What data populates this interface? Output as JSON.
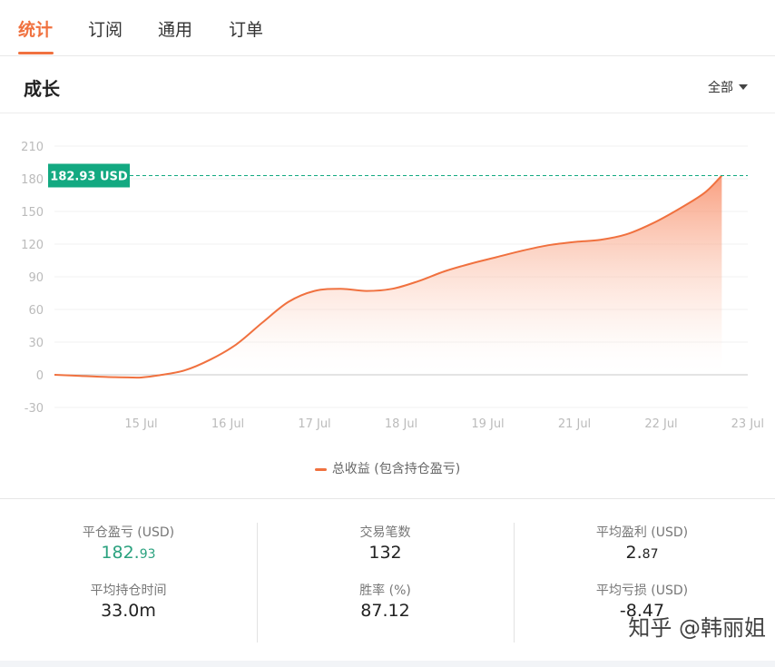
{
  "tabs": [
    {
      "label": "统计",
      "active": true
    },
    {
      "label": "订阅",
      "active": false
    },
    {
      "label": "通用",
      "active": false
    },
    {
      "label": "订单",
      "active": false
    }
  ],
  "section": {
    "title": "成长",
    "range_label": "全部"
  },
  "chart_data": {
    "type": "area",
    "series": [
      {
        "name": "总收益 (包含持仓盈亏)",
        "color": "#f0713f",
        "points": [
          [
            0.0,
            0
          ],
          [
            0.3,
            -1
          ],
          [
            0.6,
            -2
          ],
          [
            0.9,
            -2.5
          ],
          [
            1.0,
            -2.5
          ],
          [
            1.2,
            -0.5
          ],
          [
            1.5,
            4
          ],
          [
            1.8,
            14
          ],
          [
            2.1,
            28
          ],
          [
            2.4,
            48
          ],
          [
            2.7,
            67
          ],
          [
            3.0,
            77
          ],
          [
            3.3,
            79
          ],
          [
            3.6,
            77
          ],
          [
            3.9,
            79
          ],
          [
            4.2,
            86
          ],
          [
            4.5,
            95
          ],
          [
            4.8,
            102
          ],
          [
            5.1,
            108
          ],
          [
            5.4,
            114
          ],
          [
            5.7,
            119
          ],
          [
            6.0,
            122
          ],
          [
            6.3,
            124
          ],
          [
            6.6,
            129
          ],
          [
            6.9,
            139
          ],
          [
            7.2,
            152
          ],
          [
            7.5,
            167
          ],
          [
            7.7,
            182.93
          ]
        ]
      }
    ],
    "x_tick_labels": [
      "15 Jul",
      "16 Jul",
      "17 Jul",
      "18 Jul",
      "19 Jul",
      "21 Jul",
      "22 Jul",
      "23 Jul"
    ],
    "x_tick_positions": [
      1,
      2,
      3,
      4,
      5,
      6,
      7,
      8
    ],
    "xlim": [
      0,
      8
    ],
    "y_ticks": [
      -30,
      0,
      30,
      60,
      90,
      120,
      150,
      180,
      210
    ],
    "ylim": [
      -30,
      210
    ],
    "grid": true,
    "current_value": 182.93,
    "current_label": "182.93 USD",
    "marker_color": "#13a981",
    "legend_position": "bottom-center"
  },
  "stats": {
    "closed_pnl": {
      "label": "平仓盈亏 (USD)",
      "value_main": "182.",
      "value_small": "93"
    },
    "trades": {
      "label": "交易笔数",
      "value": "132"
    },
    "avg_profit": {
      "label": "平均盈利 (USD)",
      "value_main": "2.",
      "value_small": "87"
    },
    "avg_hold": {
      "label": "平均持仓时间",
      "value": "33.0m"
    },
    "win_rate": {
      "label": "胜率 (%)",
      "value": "87.12"
    },
    "avg_loss": {
      "label": "平均亏损 (USD)",
      "value": "-8.47"
    }
  },
  "watermark": "知乎 @韩丽姐",
  "colors": {
    "accent": "#f0713f",
    "green": "#2ba27f"
  }
}
